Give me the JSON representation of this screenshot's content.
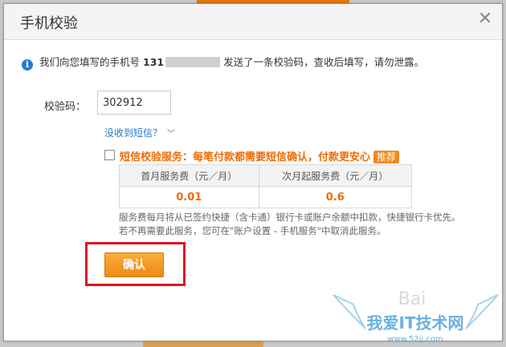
{
  "dialog": {
    "title": "手机校验",
    "close_glyph": "✕",
    "info_text_before": "我们向您填写的手机号",
    "phone_prefix": "131",
    "info_text_after": "发送了一条校验码，查收后填写，请勿泄露。",
    "code_label": "校验码：",
    "code_value": "302912",
    "no_sms_link": "没收到短信？",
    "sms_service_text": "短信校验服务：每笔付款都需要短信确认，付款更安心",
    "sms_service_checked": false,
    "recommend_badge": "推荐",
    "fee_table": {
      "headers": [
        "首月服务费（元／月）",
        "次月起服务费（元／月）"
      ],
      "values": [
        "0.01",
        "0.6"
      ]
    },
    "description_line1": "服务费每月将从已签约快捷（含卡通）银行卡或账户余额中扣款，快捷银行卡优先。",
    "description_line2": "若不再需要此服务，您可在\"账户设置 - 手机服务\"中取消此服务。",
    "confirm_label": "确认"
  },
  "watermark": {
    "main": "我爱IT技术网",
    "sub": "www.52ij.com",
    "baidu": "Bai"
  },
  "colors": {
    "accent_orange": "#f06a00",
    "link_blue": "#2a78c8",
    "highlight_red": "#e0161d"
  }
}
